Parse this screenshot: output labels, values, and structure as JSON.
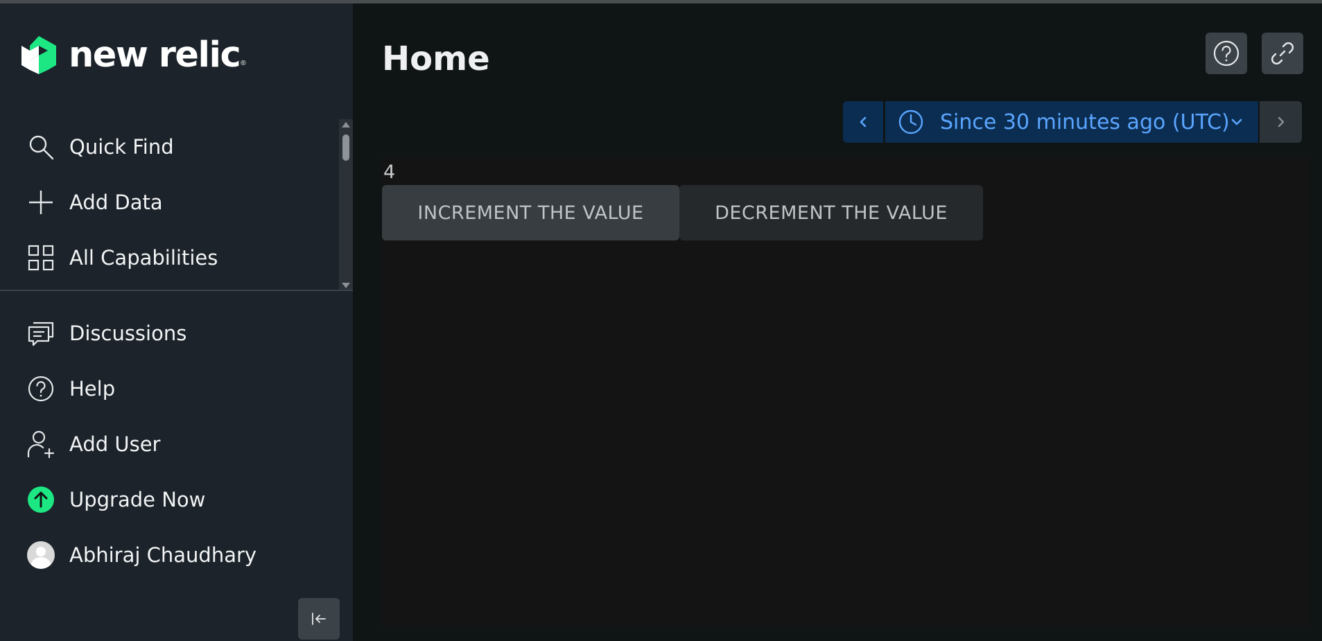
{
  "brand": {
    "name": "new relic",
    "reg": "®",
    "logo_color": "#1ce783"
  },
  "sidebar": {
    "top_items": [
      {
        "label": "Quick Find",
        "icon": "search-icon"
      },
      {
        "label": "Add Data",
        "icon": "plus-icon"
      },
      {
        "label": "All Capabilities",
        "icon": "grid-icon"
      }
    ],
    "bottom_items": [
      {
        "label": "Discussions",
        "icon": "chat-icon"
      },
      {
        "label": "Help",
        "icon": "help-circle-icon"
      },
      {
        "label": "Add User",
        "icon": "add-user-icon"
      },
      {
        "label": "Upgrade Now",
        "icon": "upgrade-arrow-icon"
      },
      {
        "label": "Abhiraj Chaudhary",
        "icon": "avatar"
      }
    ],
    "collapse_icon": "collapse-left-icon"
  },
  "header": {
    "title": "Home",
    "help_icon": "help-circle-icon",
    "link_icon": "link-icon"
  },
  "timepicker": {
    "label": "Since 30 minutes ago (UTC)",
    "prev_icon": "chevron-left-icon",
    "next_icon": "chevron-right-icon",
    "clock_icon": "clock-icon",
    "dropdown_icon": "chevron-down-icon"
  },
  "counter": {
    "value": "4",
    "increment_label": "INCREMENT THE VALUE",
    "decrement_label": "DECREMENT THE VALUE"
  },
  "colors": {
    "sidebar_bg": "#1c232a",
    "main_bg": "#0f1414",
    "accent_blue": "#5aa6ff",
    "upgrade_green": "#1ce783"
  }
}
